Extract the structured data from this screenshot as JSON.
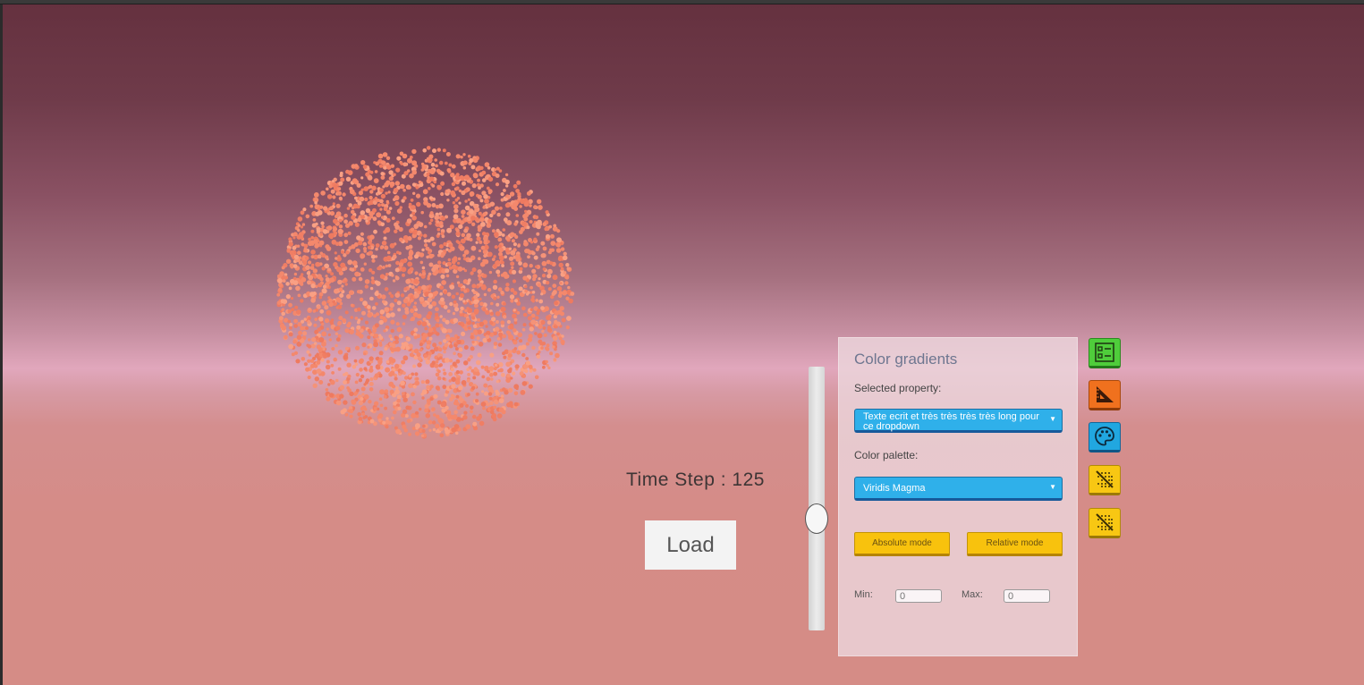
{
  "viewport": {
    "time_step_label": "Time Step : 125",
    "load_button_label": "Load",
    "time_slider": {
      "orientation": "vertical",
      "value_fraction": 0.52
    },
    "particle_cloud": {
      "color": "#f4886c",
      "shape": "sphere"
    }
  },
  "color_panel": {
    "title": "Color gradients",
    "selected_property_label": "Selected property:",
    "selected_property_value": "Texte ecrit et très très très très long pour ce dropdown",
    "color_palette_label": "Color palette:",
    "color_palette_value": "Viridis Magma",
    "absolute_mode_label": "Absolute mode",
    "relative_mode_label": "Relative mode",
    "min_label": "Min:",
    "max_label": "Max:",
    "min_placeholder": "0",
    "max_placeholder": "0"
  },
  "toolbar": {
    "buttons": [
      {
        "icon": "checklist-icon",
        "color": "#4fcd3b"
      },
      {
        "icon": "ruler-triangle-icon",
        "color": "#f0711e"
      },
      {
        "icon": "palette-icon",
        "color": "#21a7e0"
      },
      {
        "icon": "hide-points-icon",
        "color": "#f8c713"
      },
      {
        "icon": "hide-points-icon",
        "color": "#f8c713"
      }
    ]
  },
  "colors": {
    "dropdown": "#2fb0ea",
    "mode_button": "#f8c20d",
    "panel_title": "#6e7690"
  }
}
